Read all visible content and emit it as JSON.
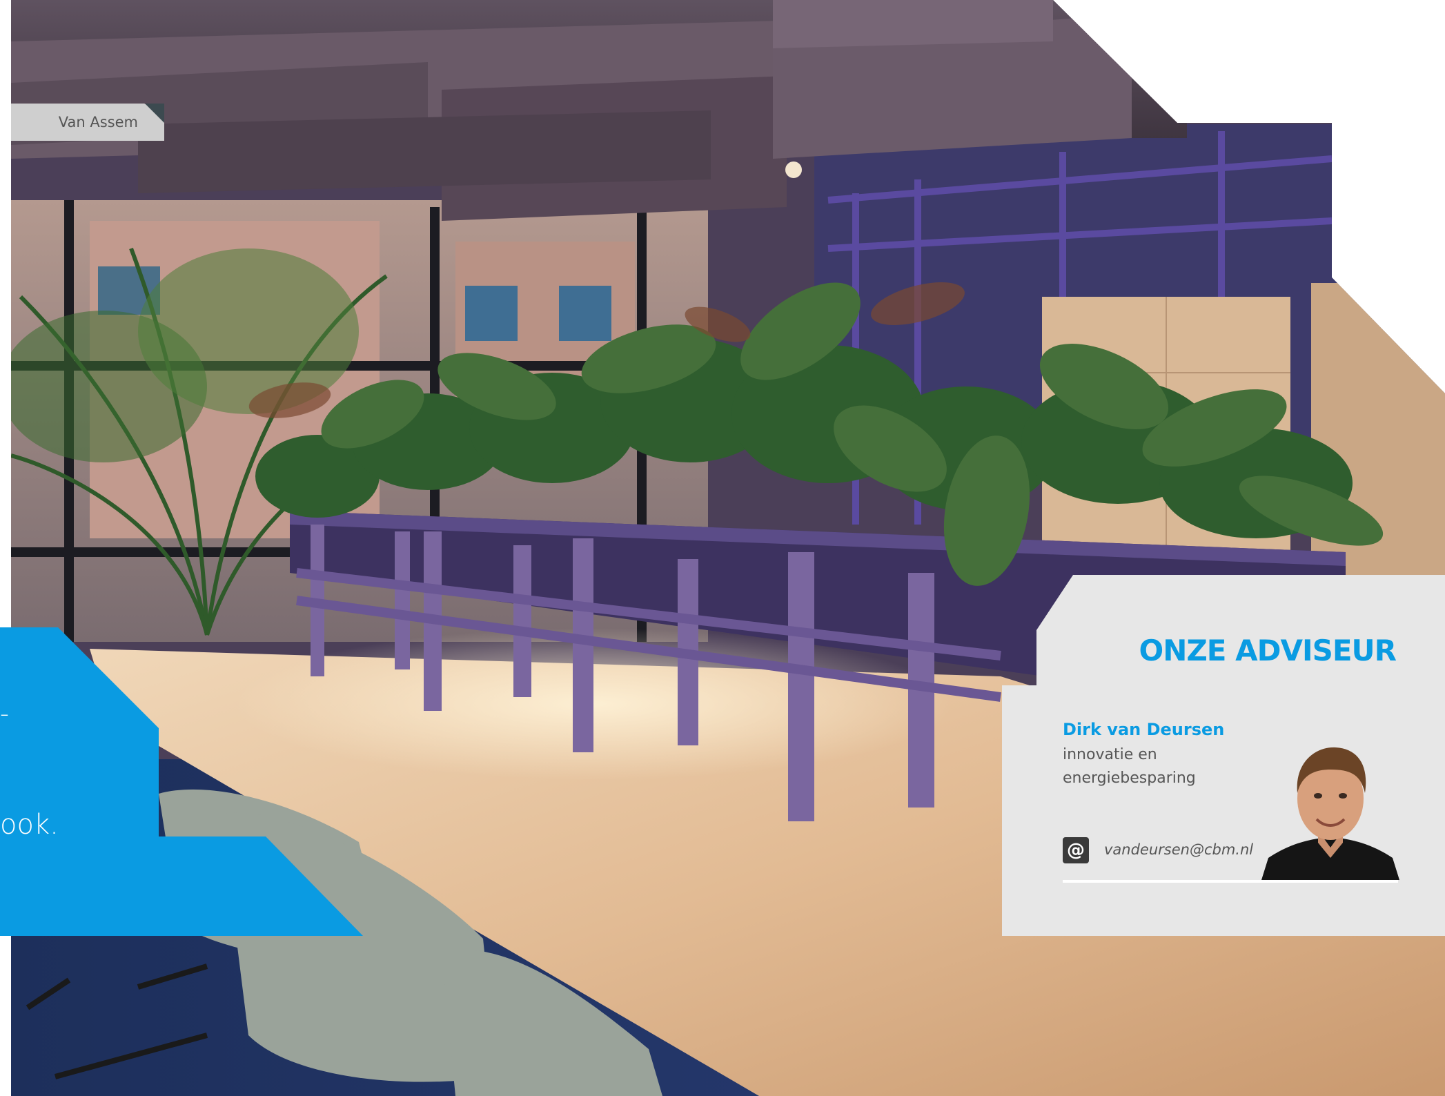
{
  "photo": {
    "credit": "Van Assem",
    "description_icon": "office-meeting-room-photo"
  },
  "intro_panel": {
    "dash_fragment": "-",
    "text_fragment": "ook."
  },
  "advisor": {
    "heading": "ONZE ADVISEUR",
    "name": "Dirk van Deursen",
    "role": "innovatie en energiebesparing",
    "email_icon": "@",
    "email": "vandeursen@cbm.nl"
  },
  "colors": {
    "accent": "#0a9be2",
    "card_bg": "#e7e7e7",
    "credit_bg": "#cfcfcf"
  }
}
